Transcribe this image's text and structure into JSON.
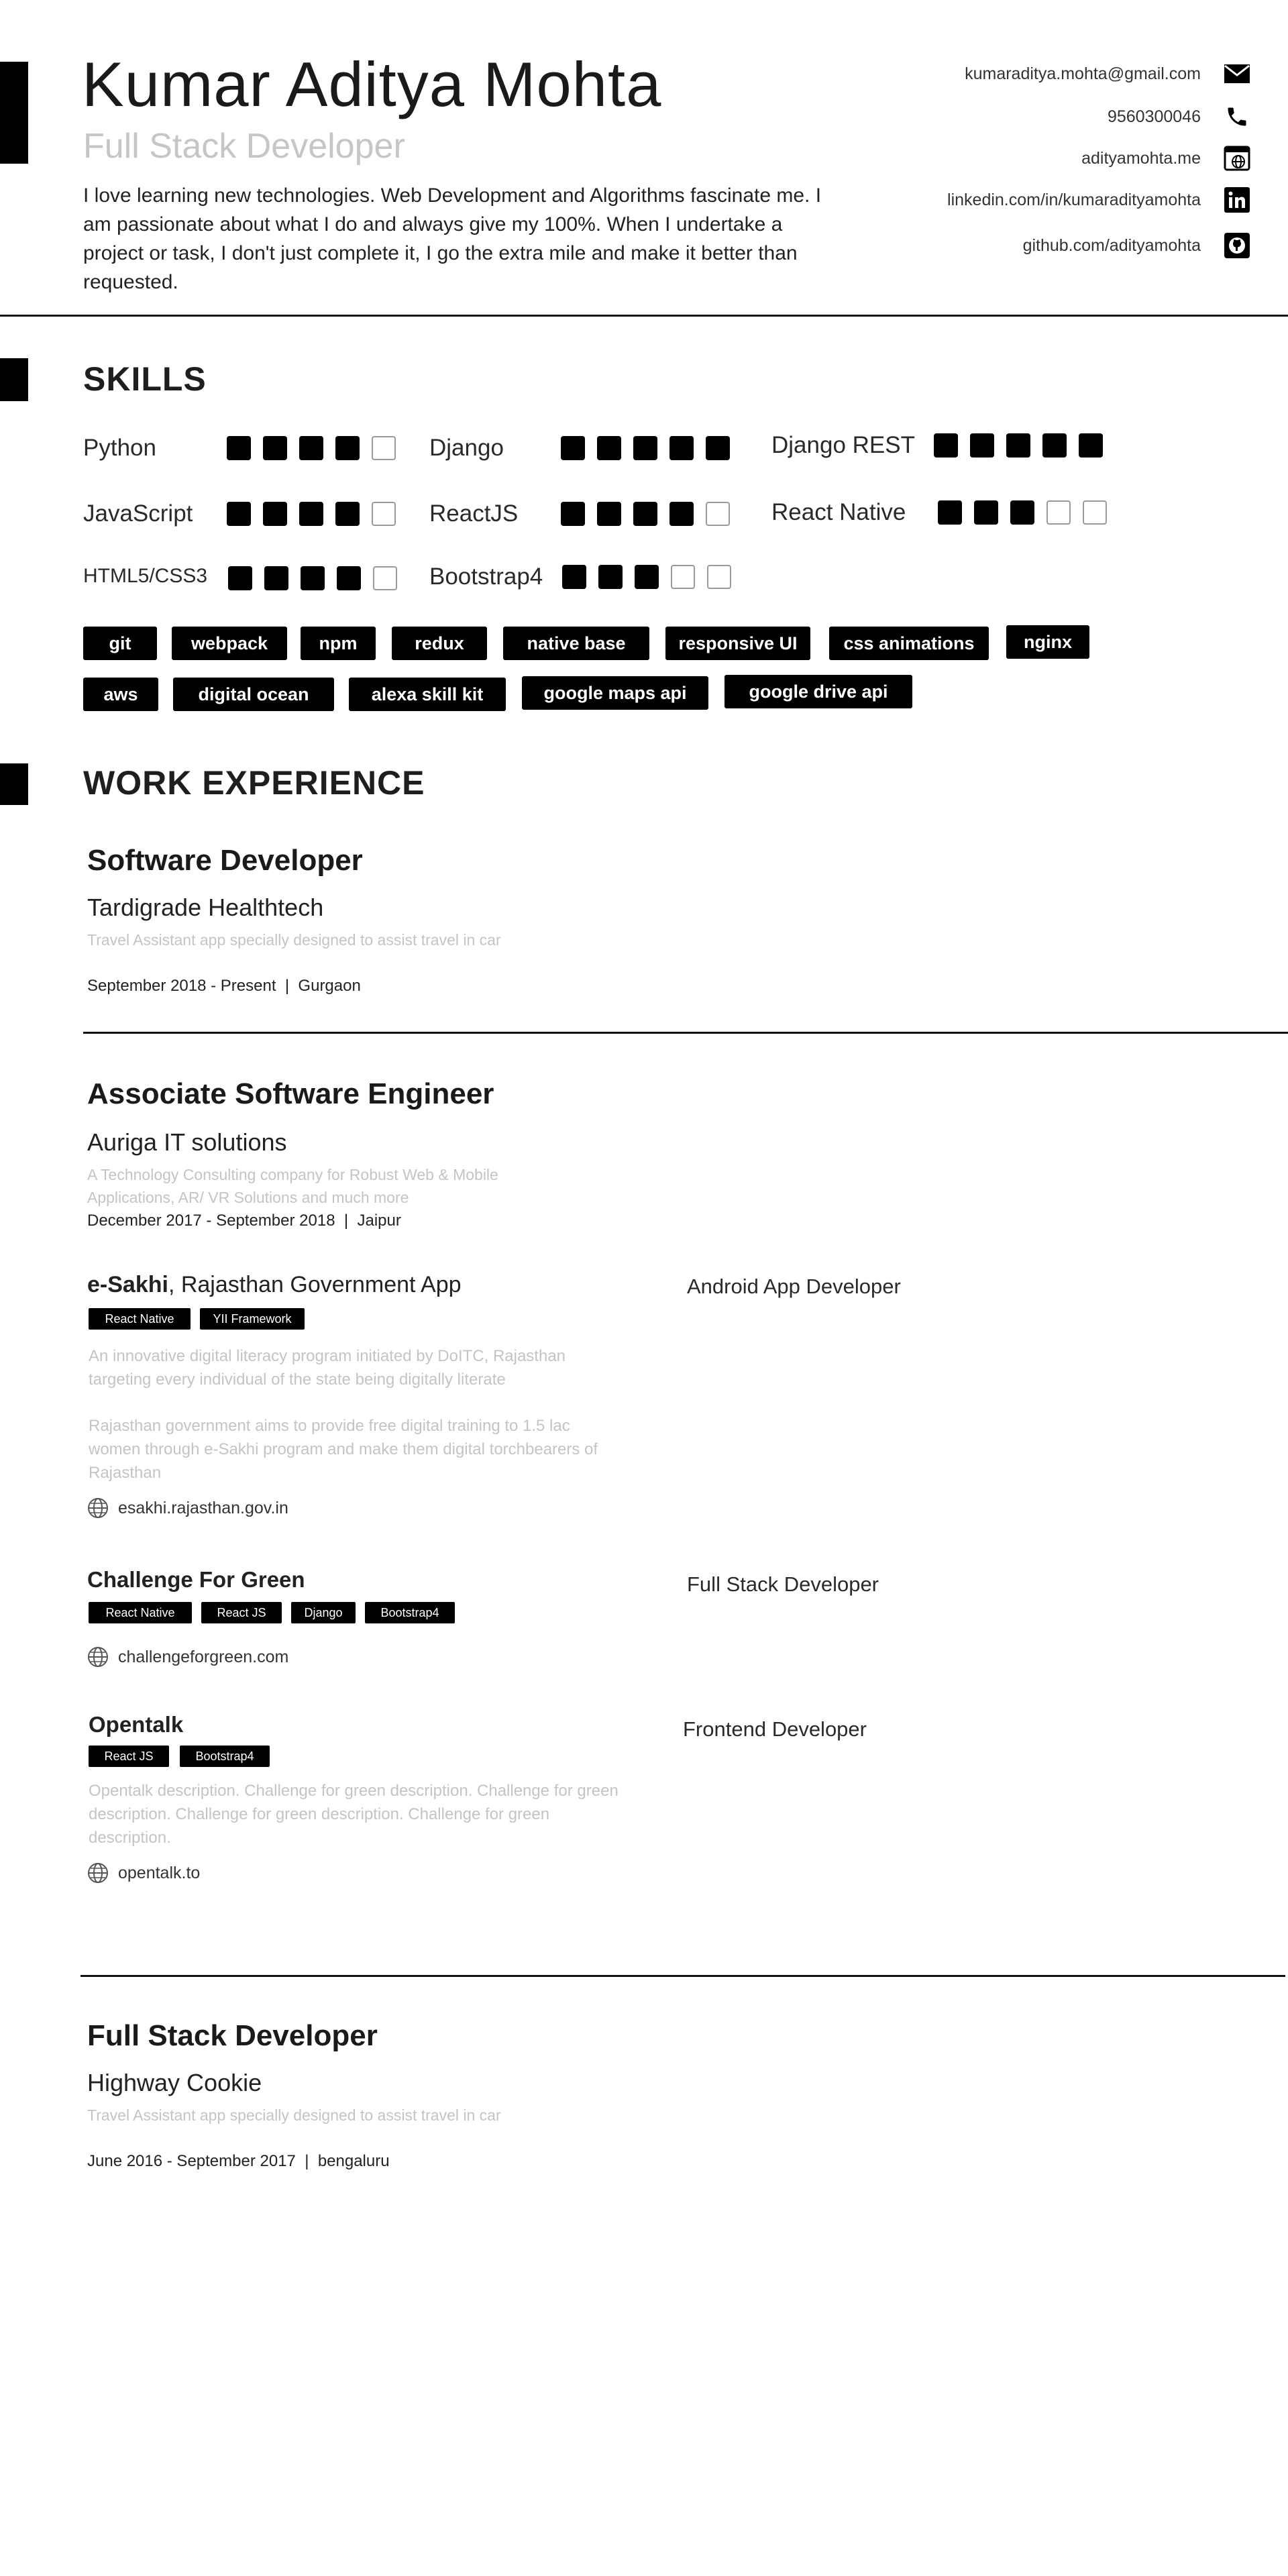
{
  "header": {
    "name": "Kumar Aditya Mohta",
    "title": "Full Stack Developer",
    "bio": "I love learning new technologies. Web Development and Algorithms fascinate me. I am passionate about what I do and always give my 100%. When I undertake a project or task, I don't just complete it, I go the extra mile and make it better than requested.",
    "contacts": [
      {
        "text": "kumaraditya.mohta@gmail.com",
        "icon": "mail-icon"
      },
      {
        "text": "9560300046",
        "icon": "phone-icon"
      },
      {
        "text": "adityamohta.me",
        "icon": "website-icon"
      },
      {
        "text": "linkedin.com/in/kumaradityamohta",
        "icon": "linkedin-icon"
      },
      {
        "text": "github.com/adityamohta",
        "icon": "github-icon"
      }
    ]
  },
  "skills": {
    "heading": "SKILLS",
    "items": [
      {
        "name": "Python",
        "rating": 4,
        "max": 5
      },
      {
        "name": "Django",
        "rating": 5,
        "max": 5
      },
      {
        "name": "Django REST",
        "rating": 5,
        "max": 5
      },
      {
        "name": "JavaScript",
        "rating": 4,
        "max": 5
      },
      {
        "name": "ReactJS",
        "rating": 4,
        "max": 5
      },
      {
        "name": "React Native",
        "rating": 3,
        "max": 5
      },
      {
        "name": "HTML5/CSS3",
        "rating": 4,
        "max": 5
      },
      {
        "name": "Bootstrap4",
        "rating": 3,
        "max": 5
      }
    ],
    "tags": [
      "git",
      "webpack",
      "npm",
      "redux",
      "native base",
      "responsive UI",
      "css animations",
      "nginx",
      "aws",
      "digital ocean",
      "alexa skill kit",
      "google maps api",
      "google drive api"
    ]
  },
  "work": {
    "heading": "WORK EXPERIENCE",
    "jobs": [
      {
        "title": "Software Developer",
        "company": "Tardigrade Healthtech",
        "description": "Travel Assistant app specially designed to assist travel in car",
        "dates": "September 2018 - Present",
        "location": "Gurgaon"
      },
      {
        "title": "Associate Software Engineer",
        "company": "Auriga IT solutions",
        "description": "A Technology Consulting company for Robust Web & Mobile Applications, AR/ VR Solutions and much more",
        "dates": "December 2017 - September 2018",
        "location": "Jaipur",
        "projects": [
          {
            "name": "e-Sakhi",
            "suffix": ", Rajasthan Government App",
            "role": "Android App Developer",
            "tags": [
              "React Native",
              "YII Framework"
            ],
            "description": "An innovative digital literacy program initiated by DoITC, Rajasthan targeting every individual of the state being digitally literate",
            "description2": "Rajasthan government aims to provide free digital training to 1.5 lac women through e-Sakhi program and make them digital torchbearers of Rajasthan",
            "link": "esakhi.rajasthan.gov.in"
          },
          {
            "name": "Challenge For Green",
            "suffix": "",
            "role": "Full Stack Developer",
            "tags": [
              "React Native",
              "React JS",
              "Django",
              "Bootstrap4"
            ],
            "link": "challengeforgreen.com"
          },
          {
            "name": "Opentalk",
            "suffix": "",
            "role": "Frontend Developer",
            "tags": [
              "React JS",
              "Bootstrap4"
            ],
            "description": "Opentalk description. Challenge for green description. Challenge for green description. Challenge for green description. Challenge for green description.",
            "link": "opentalk.to"
          }
        ]
      },
      {
        "title": "Full Stack Developer",
        "company": "Highway Cookie",
        "description": "Travel Assistant app specially designed to assist travel in car",
        "dates": "June 2016 - September 2017",
        "location": "bengaluru"
      }
    ]
  }
}
